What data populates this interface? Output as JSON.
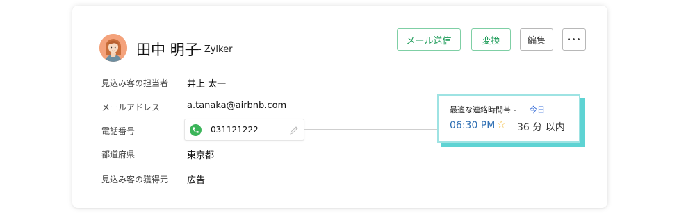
{
  "lead": {
    "name": "田中 明子",
    "company": "- Zylker"
  },
  "actions": {
    "send_email": "メール送信",
    "convert": "変換",
    "edit": "編集",
    "more": "•••"
  },
  "fields": [
    {
      "label": "見込み客の担当者",
      "value": "井上 太一"
    },
    {
      "label": "メールアドレス",
      "value": "a.tanaka@airbnb.com"
    },
    {
      "label": "電話番号",
      "value": "031121222"
    },
    {
      "label": "都道府県",
      "value": "東京都"
    },
    {
      "label": "見込み客の獲得元",
      "value": "広告"
    }
  ],
  "contact_popup": {
    "title": "最適な連絡時間帯 -",
    "day": "今日",
    "time": "06:30 PM",
    "duration": "36 分 以内"
  },
  "colors": {
    "accent_green": "#1a9a56",
    "phone_icon": "#3cb55a",
    "popup_teal": "#5ed3d3",
    "time_blue": "#2f6fb3",
    "star": "#f2b630"
  },
  "icons": [
    "avatar",
    "phone-icon",
    "pencil-icon",
    "star-icon"
  ]
}
